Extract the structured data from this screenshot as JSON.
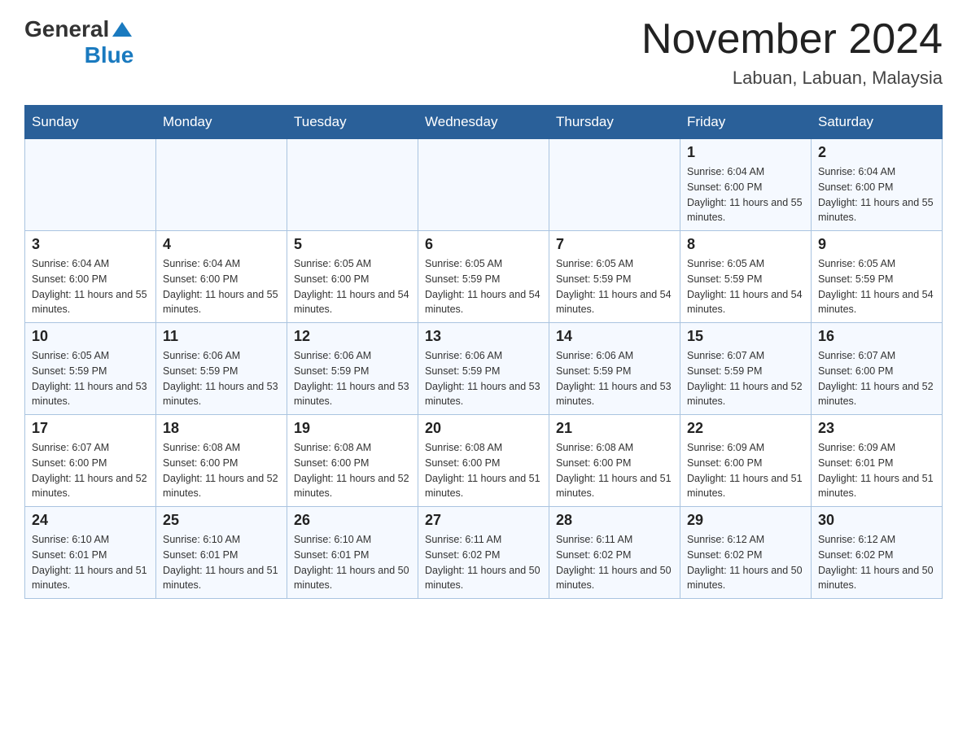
{
  "header": {
    "logo": {
      "general": "General",
      "arrow_symbol": "▶",
      "blue": "Blue"
    },
    "title": "November 2024",
    "location": "Labuan, Labuan, Malaysia"
  },
  "weekdays": [
    "Sunday",
    "Monday",
    "Tuesday",
    "Wednesday",
    "Thursday",
    "Friday",
    "Saturday"
  ],
  "weeks": [
    {
      "days": [
        {
          "num": "",
          "info": ""
        },
        {
          "num": "",
          "info": ""
        },
        {
          "num": "",
          "info": ""
        },
        {
          "num": "",
          "info": ""
        },
        {
          "num": "",
          "info": ""
        },
        {
          "num": "1",
          "info": "Sunrise: 6:04 AM\nSunset: 6:00 PM\nDaylight: 11 hours and 55 minutes."
        },
        {
          "num": "2",
          "info": "Sunrise: 6:04 AM\nSunset: 6:00 PM\nDaylight: 11 hours and 55 minutes."
        }
      ]
    },
    {
      "days": [
        {
          "num": "3",
          "info": "Sunrise: 6:04 AM\nSunset: 6:00 PM\nDaylight: 11 hours and 55 minutes."
        },
        {
          "num": "4",
          "info": "Sunrise: 6:04 AM\nSunset: 6:00 PM\nDaylight: 11 hours and 55 minutes."
        },
        {
          "num": "5",
          "info": "Sunrise: 6:05 AM\nSunset: 6:00 PM\nDaylight: 11 hours and 54 minutes."
        },
        {
          "num": "6",
          "info": "Sunrise: 6:05 AM\nSunset: 5:59 PM\nDaylight: 11 hours and 54 minutes."
        },
        {
          "num": "7",
          "info": "Sunrise: 6:05 AM\nSunset: 5:59 PM\nDaylight: 11 hours and 54 minutes."
        },
        {
          "num": "8",
          "info": "Sunrise: 6:05 AM\nSunset: 5:59 PM\nDaylight: 11 hours and 54 minutes."
        },
        {
          "num": "9",
          "info": "Sunrise: 6:05 AM\nSunset: 5:59 PM\nDaylight: 11 hours and 54 minutes."
        }
      ]
    },
    {
      "days": [
        {
          "num": "10",
          "info": "Sunrise: 6:05 AM\nSunset: 5:59 PM\nDaylight: 11 hours and 53 minutes."
        },
        {
          "num": "11",
          "info": "Sunrise: 6:06 AM\nSunset: 5:59 PM\nDaylight: 11 hours and 53 minutes."
        },
        {
          "num": "12",
          "info": "Sunrise: 6:06 AM\nSunset: 5:59 PM\nDaylight: 11 hours and 53 minutes."
        },
        {
          "num": "13",
          "info": "Sunrise: 6:06 AM\nSunset: 5:59 PM\nDaylight: 11 hours and 53 minutes."
        },
        {
          "num": "14",
          "info": "Sunrise: 6:06 AM\nSunset: 5:59 PM\nDaylight: 11 hours and 53 minutes."
        },
        {
          "num": "15",
          "info": "Sunrise: 6:07 AM\nSunset: 5:59 PM\nDaylight: 11 hours and 52 minutes."
        },
        {
          "num": "16",
          "info": "Sunrise: 6:07 AM\nSunset: 6:00 PM\nDaylight: 11 hours and 52 minutes."
        }
      ]
    },
    {
      "days": [
        {
          "num": "17",
          "info": "Sunrise: 6:07 AM\nSunset: 6:00 PM\nDaylight: 11 hours and 52 minutes."
        },
        {
          "num": "18",
          "info": "Sunrise: 6:08 AM\nSunset: 6:00 PM\nDaylight: 11 hours and 52 minutes."
        },
        {
          "num": "19",
          "info": "Sunrise: 6:08 AM\nSunset: 6:00 PM\nDaylight: 11 hours and 52 minutes."
        },
        {
          "num": "20",
          "info": "Sunrise: 6:08 AM\nSunset: 6:00 PM\nDaylight: 11 hours and 51 minutes."
        },
        {
          "num": "21",
          "info": "Sunrise: 6:08 AM\nSunset: 6:00 PM\nDaylight: 11 hours and 51 minutes."
        },
        {
          "num": "22",
          "info": "Sunrise: 6:09 AM\nSunset: 6:00 PM\nDaylight: 11 hours and 51 minutes."
        },
        {
          "num": "23",
          "info": "Sunrise: 6:09 AM\nSunset: 6:01 PM\nDaylight: 11 hours and 51 minutes."
        }
      ]
    },
    {
      "days": [
        {
          "num": "24",
          "info": "Sunrise: 6:10 AM\nSunset: 6:01 PM\nDaylight: 11 hours and 51 minutes."
        },
        {
          "num": "25",
          "info": "Sunrise: 6:10 AM\nSunset: 6:01 PM\nDaylight: 11 hours and 51 minutes."
        },
        {
          "num": "26",
          "info": "Sunrise: 6:10 AM\nSunset: 6:01 PM\nDaylight: 11 hours and 50 minutes."
        },
        {
          "num": "27",
          "info": "Sunrise: 6:11 AM\nSunset: 6:02 PM\nDaylight: 11 hours and 50 minutes."
        },
        {
          "num": "28",
          "info": "Sunrise: 6:11 AM\nSunset: 6:02 PM\nDaylight: 11 hours and 50 minutes."
        },
        {
          "num": "29",
          "info": "Sunrise: 6:12 AM\nSunset: 6:02 PM\nDaylight: 11 hours and 50 minutes."
        },
        {
          "num": "30",
          "info": "Sunrise: 6:12 AM\nSunset: 6:02 PM\nDaylight: 11 hours and 50 minutes."
        }
      ]
    }
  ]
}
